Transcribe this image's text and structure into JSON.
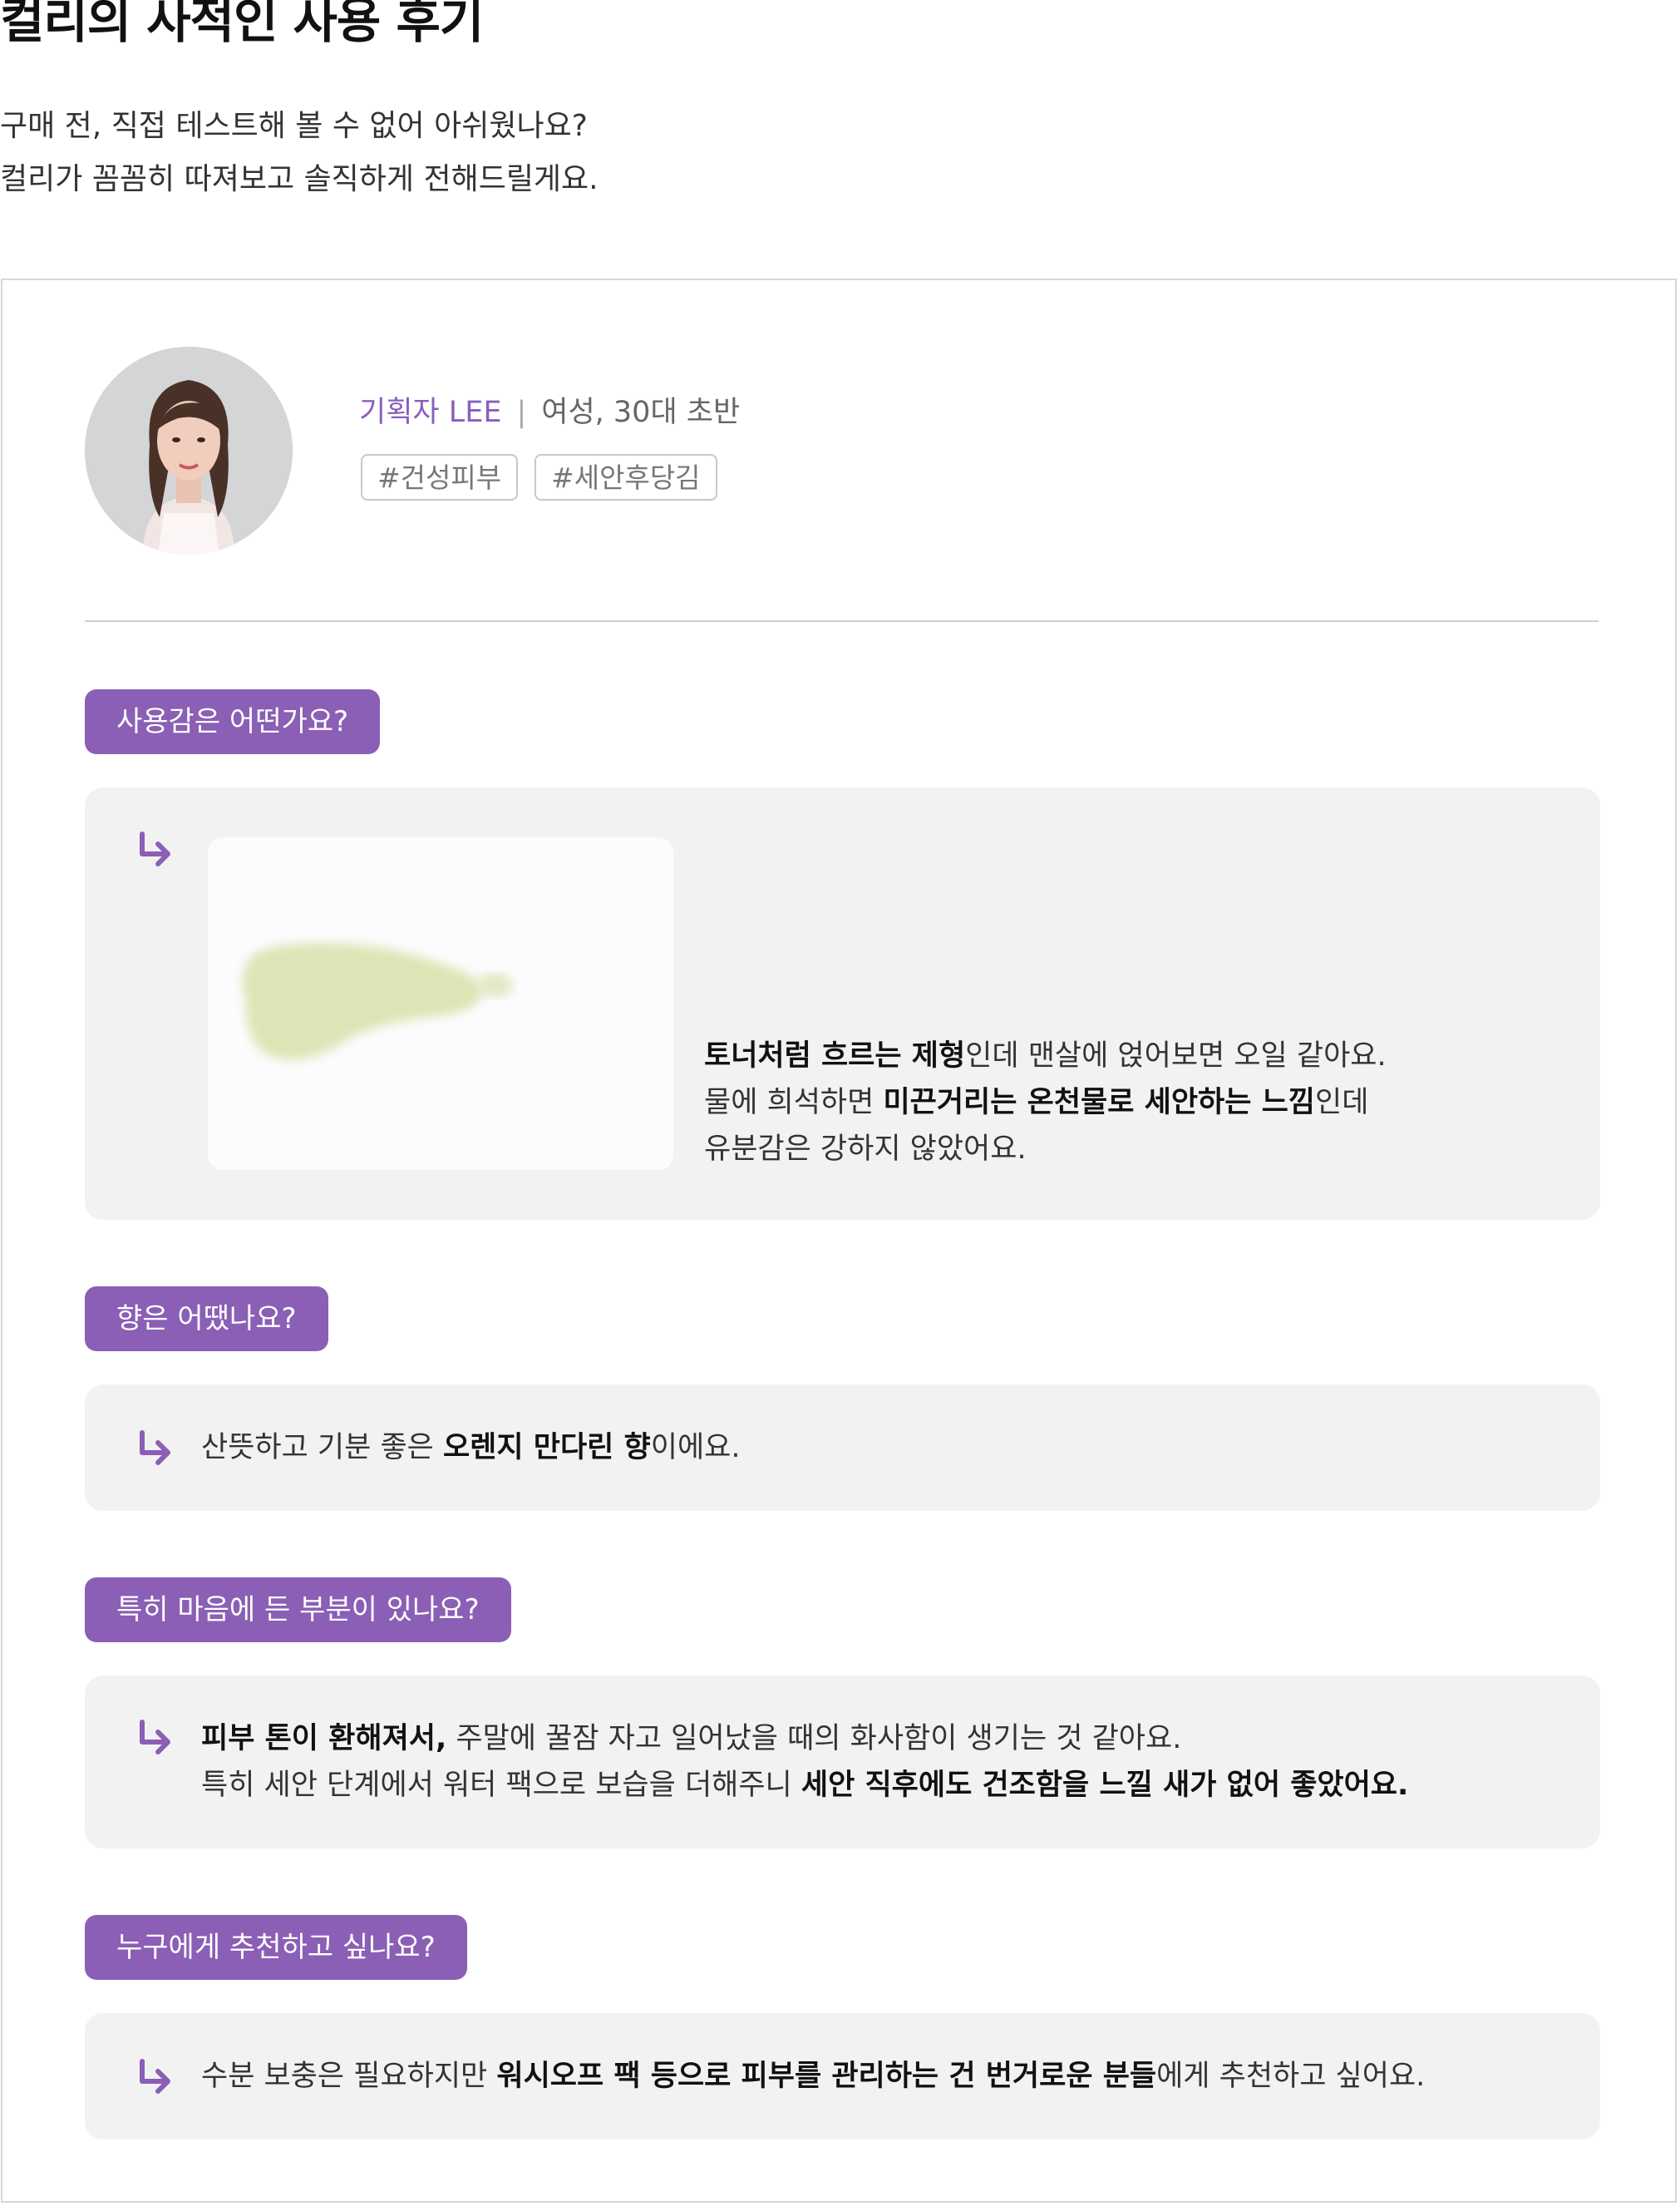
{
  "page": {
    "title": "컬리의 사적인 사용 후기",
    "intro_lines": [
      "구매 전, 직접 테스트해 볼 수 없어 아쉬웠나요?",
      "컬리가 꼼꼼히 따져보고 솔직하게 전해드릴게요."
    ]
  },
  "reviewer": {
    "name": "기획자 LEE",
    "separator": "|",
    "info": "여성, 30대 초반",
    "tags": [
      "#건성피부",
      "#세안후당김"
    ]
  },
  "qa": [
    {
      "question": "사용감은 어떤가요?",
      "lines": [
        [
          {
            "b": "토너처럼 흐르는 제형"
          },
          {
            "t": "인데 맨살에 얹어보면 오일 같아요."
          }
        ],
        [
          {
            "t": "물에 희석하면 "
          },
          {
            "b": "미끈거리는 온천물로 세안하는 느낌"
          },
          {
            "t": "인데"
          }
        ],
        [
          {
            "t": "유분감은 강하지 않았어요."
          }
        ]
      ]
    },
    {
      "question": "향은 어땠나요?",
      "lines": [
        [
          {
            "t": "산뜻하고 기분 좋은 "
          },
          {
            "b": "오렌지 만다린 향"
          },
          {
            "t": "이에요."
          }
        ]
      ]
    },
    {
      "question": "특히 마음에 든 부분이 있나요?",
      "lines": [
        [
          {
            "b": "피부 톤이 환해져서,"
          },
          {
            "t": " 주말에 꿀잠 자고 일어났을 때의 화사함이 생기는 것 같아요."
          }
        ],
        [
          {
            "t": "특히 세안 단계에서 워터 팩으로 보습을 더해주니 "
          },
          {
            "b": "세안 직후에도 건조함을 느낄 새가 없어 좋았어요."
          }
        ]
      ]
    },
    {
      "question": "누구에게 추천하고 싶나요?",
      "lines": [
        [
          {
            "t": "수분 보충은 필요하지만 "
          },
          {
            "b": "워시오프 팩 등으로 피부를 관리하는 건 번거로운 분들"
          },
          {
            "t": "에게 추천하고 싶어요."
          }
        ]
      ]
    }
  ],
  "colors": {
    "accent": "#8a5fb5",
    "answer_bg": "#f2f2f2",
    "texture": "#dfe4b6"
  },
  "icons": {
    "answer_arrow": "return-arrow-icon"
  }
}
